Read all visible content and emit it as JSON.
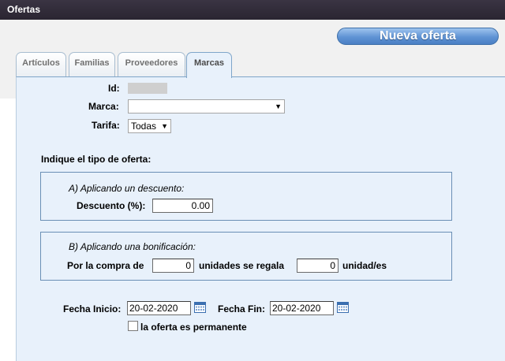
{
  "window": {
    "title": "Ofertas"
  },
  "toolbar": {
    "new_offer_label": "Nueva oferta"
  },
  "tabs": [
    {
      "label": "Artículos"
    },
    {
      "label": "Familias"
    },
    {
      "label": "Proveedores"
    },
    {
      "label": "Marcas"
    }
  ],
  "form": {
    "id_label": "Id:",
    "id_value": "",
    "marca_label": "Marca:",
    "marca_value": "",
    "tarifa_label": "Tarifa:",
    "tarifa_value": "Todas",
    "tipo_heading": "Indique el tipo de oferta:"
  },
  "descuento": {
    "legend": "A) Aplicando un descuento:",
    "label": "Descuento (%):",
    "value": "0.00"
  },
  "bonificacion": {
    "legend": "B) Aplicando una bonificación:",
    "compra_label": "Por la compra de",
    "compra_value": "0",
    "regala_label": "unidades se regala",
    "regala_value": "0",
    "unidad_label": "unidad/es"
  },
  "fechas": {
    "inicio_label": "Fecha Inicio:",
    "inicio_value": "20-02-2020",
    "fin_label": "Fecha Fin:",
    "fin_value": "20-02-2020",
    "permanente_label": "la oferta es permanente",
    "permanente_checked": false
  },
  "icons": {
    "calendar": "calendar-icon",
    "dropdown": "chevron-down-icon"
  }
}
